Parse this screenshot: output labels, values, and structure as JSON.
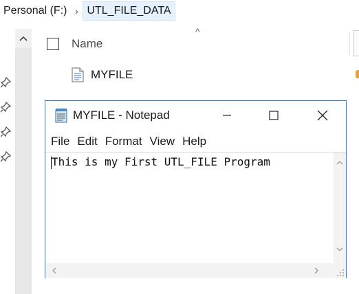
{
  "breadcrumb": {
    "drive": "Personal (F:)",
    "separator": "›",
    "folder": "UTL_FILE_DATA"
  },
  "list": {
    "column_name": "Name",
    "sort_indicator": "^",
    "files": [
      {
        "name": "MYFILE",
        "icon": "text-file-icon"
      }
    ]
  },
  "notepad": {
    "title": "MYFILE - Notepad",
    "icon": "notepad-icon",
    "menu": [
      "File",
      "Edit",
      "Format",
      "View",
      "Help"
    ],
    "content": "This is my First UTL_FILE Program"
  },
  "colors": {
    "window_border": "#2b79d0",
    "breadcrumb_highlight": "#e5f1fb",
    "scrollbar": "#f3f3f3"
  }
}
